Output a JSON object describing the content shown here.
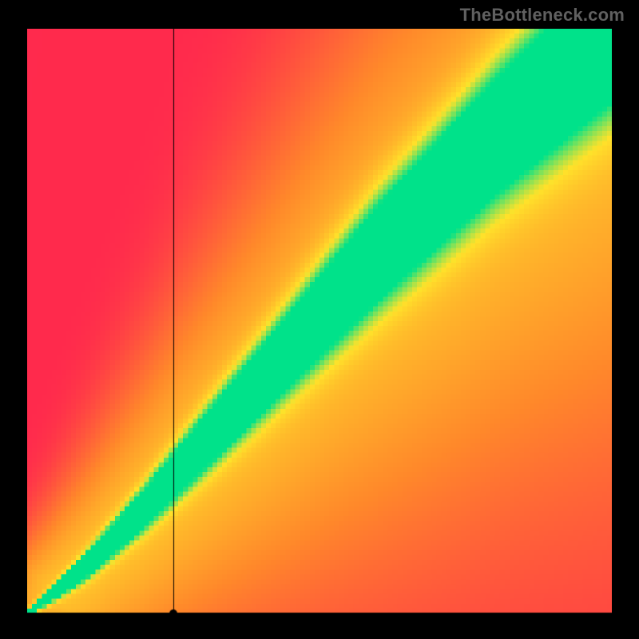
{
  "watermark": "TheBottleneck.com",
  "colors": {
    "red": "#ff2a4d",
    "orange": "#ff8a2a",
    "yellow": "#ffe22a",
    "green": "#00e28a",
    "crosshair": "#000000"
  },
  "chart_data": {
    "type": "heatmap",
    "title": "",
    "xlabel": "",
    "ylabel": "",
    "xlim": [
      0,
      100
    ],
    "ylim": [
      0,
      100
    ],
    "resolution": 120,
    "optimal_band": {
      "description": "Diagonal optimal-performance band (green) with smooth falloff through yellow→orange→red. Band widens toward the top-right and has a slight S-curve near the origin.",
      "curve_points_x": [
        0,
        4,
        10,
        20,
        40,
        60,
        80,
        100
      ],
      "curve_points_y": [
        0,
        3,
        8,
        18,
        40,
        62,
        82,
        100
      ],
      "half_width_at_x": [
        0.4,
        0.8,
        1.5,
        2.5,
        4.5,
        6.5,
        8.0,
        9.5
      ]
    },
    "marker": {
      "x": 25,
      "y": 0,
      "note": "crosshair dot on x-axis with vertical guide line"
    }
  }
}
